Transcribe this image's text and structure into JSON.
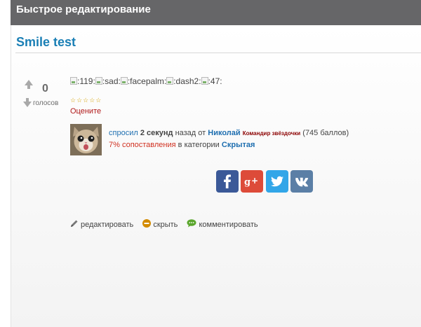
{
  "header": {
    "title": "Быстрое редактирование"
  },
  "question": {
    "title": "Smile test",
    "body_smiles": [
      ":119:",
      ":sad:",
      ":facepalm:",
      ":dash2:",
      ":47:"
    ],
    "votes": {
      "count": "0",
      "label": "голосов"
    },
    "rating": {
      "stars": "☆☆☆☆☆",
      "label": "Оцените"
    },
    "meta": {
      "asked": "спросил",
      "time": "2 секунд",
      "ago_by": "назад от",
      "user": "Николай",
      "rank": "Командир звёздочки",
      "points": "(745 баллов)",
      "match": "7% сопоставления",
      "in_category": "в категории",
      "category": "Скрытая"
    }
  },
  "share": [
    "facebook-icon",
    "google-plus-icon",
    "twitter-icon",
    "vk-icon"
  ],
  "share_colors": {
    "facebook": "#3b5998",
    "google_plus": "#dd4b39",
    "twitter": "#32a6e8",
    "vk": "#5b7fa6"
  },
  "actions": {
    "edit": "редактировать",
    "hide": "скрыть",
    "comment": "комментировать"
  }
}
